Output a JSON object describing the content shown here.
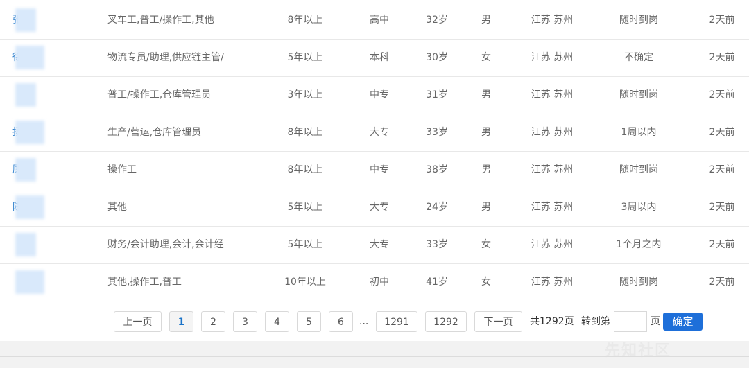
{
  "rows": [
    {
      "name": "张",
      "jobs": "叉车工,普工/操作工,其他",
      "exp": "8年以上",
      "edu": "高中",
      "age": "32岁",
      "sex": "男",
      "loc": "江苏 苏州",
      "avail": "随时到岗",
      "updated": "2天前"
    },
    {
      "name": "徐",
      "jobs": "物流专员/助理,供应链主管/",
      "exp": "5年以上",
      "edu": "本科",
      "age": "30岁",
      "sex": "女",
      "loc": "江苏 苏州",
      "avail": "不确定",
      "updated": "2天前"
    },
    {
      "name": "",
      "jobs": "普工/操作工,仓库管理员",
      "exp": "3年以上",
      "edu": "中专",
      "age": "31岁",
      "sex": "男",
      "loc": "江苏 苏州",
      "avail": "随时到岗",
      "updated": "2天前"
    },
    {
      "name": "扬",
      "jobs": "生产/营运,仓库管理员",
      "exp": "8年以上",
      "edu": "大专",
      "age": "33岁",
      "sex": "男",
      "loc": "江苏 苏州",
      "avail": "1周以内",
      "updated": "2天前"
    },
    {
      "name": "顾铭",
      "jobs": "操作工",
      "exp": "8年以上",
      "edu": "中专",
      "age": "38岁",
      "sex": "男",
      "loc": "江苏 苏州",
      "avail": "随时到岗",
      "updated": "2天前"
    },
    {
      "name": "陈",
      "jobs": "其他",
      "exp": "5年以上",
      "edu": "大专",
      "age": "24岁",
      "sex": "男",
      "loc": "江苏 苏州",
      "avail": "3周以内",
      "updated": "2天前"
    },
    {
      "name": "",
      "jobs": "财务/会计助理,会计,会计经",
      "exp": "5年以上",
      "edu": "大专",
      "age": "33岁",
      "sex": "女",
      "loc": "江苏 苏州",
      "avail": "1个月之内",
      "updated": "2天前"
    },
    {
      "name": "",
      "jobs": "其他,操作工,普工",
      "exp": "10年以上",
      "edu": "初中",
      "age": "41岁",
      "sex": "女",
      "loc": "江苏 苏州",
      "avail": "随时到岗",
      "updated": "2天前"
    }
  ],
  "pagination": {
    "prev": "上一页",
    "pages": [
      "1",
      "2",
      "3",
      "4",
      "5",
      "6"
    ],
    "ellipsis": "...",
    "tail": [
      "1291",
      "1292"
    ],
    "next": "下一页",
    "total_pages": "共1292页",
    "goto_label": "转到第",
    "page_unit": "页",
    "confirm": "确定",
    "current": "1"
  },
  "watermark": "先知社区"
}
